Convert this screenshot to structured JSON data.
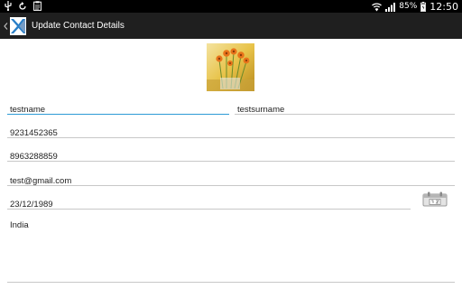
{
  "status_bar": {
    "battery_percent": "85%",
    "time": "12:50"
  },
  "action_bar": {
    "title": "Update Contact Details"
  },
  "form": {
    "first_name": "testname",
    "last_name": "testsurname",
    "phone_1": "9231452365",
    "phone_2": "8963288859",
    "email": "test@gmail.com",
    "date_of_birth": "23/12/1989",
    "address": "India"
  },
  "icons": {
    "usb": "usb-icon",
    "sync": "sync-icon",
    "clipboard": "clipboard-icon",
    "wifi": "wifi-icon",
    "signal": "signal-icon",
    "battery": "battery-icon",
    "calendar": "calendar-icon"
  }
}
